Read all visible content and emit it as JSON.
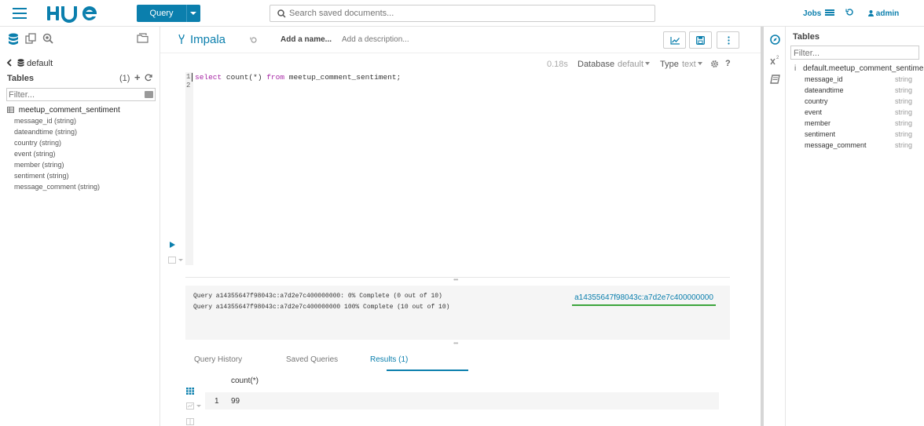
{
  "topbar": {
    "logo_text": "HUE",
    "query_button": "Query",
    "search_placeholder": "Search saved documents...",
    "jobs_label": "Jobs",
    "user_label": "admin"
  },
  "left_panel": {
    "database": "default",
    "tables_title": "Tables",
    "tables_count": "(1)",
    "filter_placeholder": "Filter...",
    "table_name": "meetup_comment_sentiment",
    "columns": [
      "message_id (string)",
      "dateandtime (string)",
      "country (string)",
      "event (string)",
      "member (string)",
      "sentiment (string)",
      "message_comment (string)"
    ]
  },
  "editor": {
    "engine": "Impala",
    "name_placeholder": "Add a name...",
    "description_placeholder": "Add a description...",
    "elapsed": "0.18s",
    "database_label": "Database",
    "database_value": "default",
    "type_label": "Type",
    "type_value": "text",
    "help": "?",
    "line_numbers": [
      "1",
      "2"
    ],
    "code": {
      "kw1": "select",
      "fn": " count(*) ",
      "kw2": "from",
      "rest": " meetup_comment_sentiment;"
    }
  },
  "log": {
    "lines": [
      "Query a14355647f98043c:a7d2e7c400000000: 0% Complete (0 out of 10)",
      "Query a14355647f98043c:a7d2e7c400000000 100% Complete (10 out of 10)"
    ],
    "job_link": "a14355647f98043c:a7d2e7c400000000"
  },
  "result_tabs": [
    {
      "label": "Query History",
      "active": false
    },
    {
      "label": "Saved Queries",
      "active": false
    },
    {
      "label": "Results (1)",
      "active": true
    }
  ],
  "results": {
    "column_header": "count(*)",
    "rows": [
      {
        "index": "1",
        "value": "99"
      }
    ]
  },
  "assist": {
    "title": "Tables",
    "filter_placeholder": "Filter...",
    "info": "i",
    "table": "default.meetup_comment_sentimen",
    "columns": [
      {
        "name": "message_id",
        "type": "string"
      },
      {
        "name": "dateandtime",
        "type": "string"
      },
      {
        "name": "country",
        "type": "string"
      },
      {
        "name": "event",
        "type": "string"
      },
      {
        "name": "member",
        "type": "string"
      },
      {
        "name": "sentiment",
        "type": "string"
      },
      {
        "name": "message_comment",
        "type": "string"
      }
    ]
  },
  "colors": {
    "accent": "#0b7fad",
    "success": "#3ca53c",
    "keyword": "#a626a4"
  }
}
